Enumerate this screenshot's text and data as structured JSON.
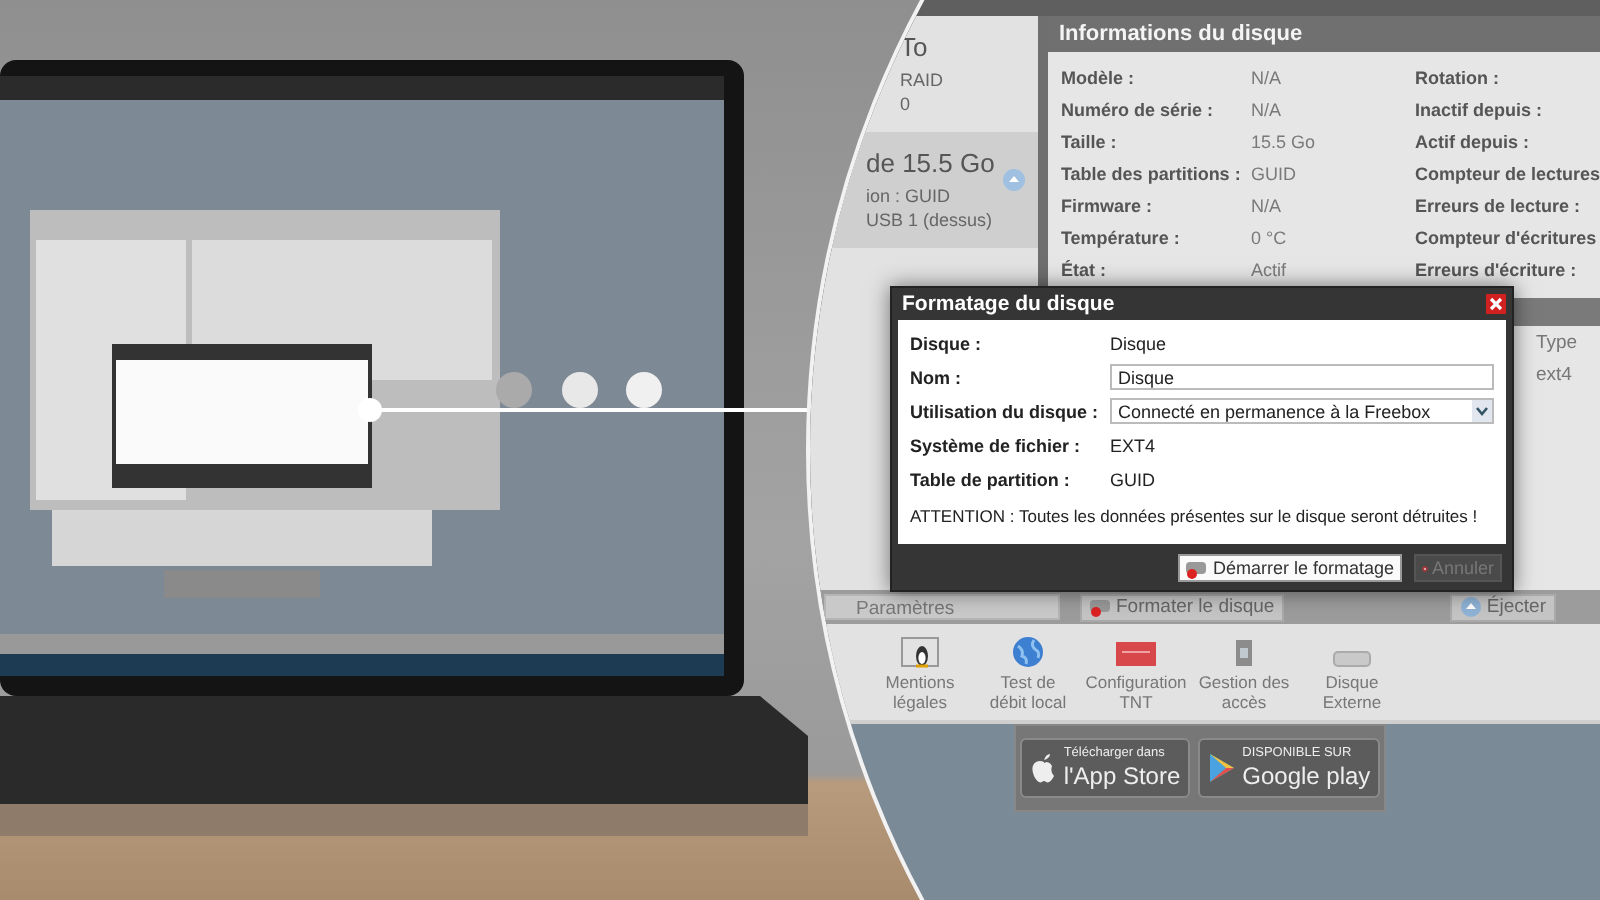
{
  "disk_list": {
    "items": [
      {
        "lines": [
          "To",
          "RAID",
          "0"
        ],
        "selected": false
      },
      {
        "lines": [
          "de 15.5 Go",
          "ion : GUID",
          "USB 1 (dessus)"
        ],
        "selected": true
      }
    ]
  },
  "disk_info": {
    "title": "Informations du disque",
    "rows": [
      {
        "label": "Modèle :",
        "value": "N/A",
        "label_2": "Rotation :"
      },
      {
        "label": "Numéro de série :",
        "value": "N/A",
        "label_2": "Inactif depuis :"
      },
      {
        "label": "Taille :",
        "value": "15.5 Go",
        "label_2": "Actif depuis :"
      },
      {
        "label": "Table des partitions :",
        "value": "GUID",
        "label_2": "Compteur de lectures"
      },
      {
        "label": "Firmware :",
        "value": "N/A",
        "label_2": "Erreurs de lecture :"
      },
      {
        "label": "Température :",
        "value": "0 °C",
        "label_2": "Compteur d'écritures"
      },
      {
        "label": "État :",
        "value": "Actif",
        "label_2": "Erreurs d'écriture :"
      }
    ]
  },
  "partitions_table": {
    "columns": [
      "Type"
    ],
    "rows": [
      [
        "ext4"
      ]
    ]
  },
  "format_dialog": {
    "title": "Formatage du disque",
    "fields": [
      {
        "kind": "text",
        "label": "Disque :",
        "value": "Disque"
      },
      {
        "kind": "input",
        "label": "Nom :",
        "value": "Disque"
      },
      {
        "kind": "select",
        "label": "Utilisation du disque :",
        "value": "Connecté en permanence à la Freebox"
      },
      {
        "kind": "text",
        "label": "Système de fichier :",
        "value": "EXT4"
      },
      {
        "kind": "text",
        "label": "Table de partition :",
        "value": "GUID"
      }
    ],
    "warning": "ATTENTION : Toutes les données présentes sur le disque seront détruites !",
    "buttons": [
      {
        "label": "Démarrer le formatage",
        "disabled": false
      },
      {
        "label": "Annuler",
        "disabled": true
      }
    ]
  },
  "toolbar": {
    "field": "Paramètres",
    "buttons": [
      {
        "label": "Formater le disque",
        "kind": "format"
      },
      {
        "label": "Éjecter",
        "kind": "eject"
      }
    ]
  },
  "apps": [
    {
      "kind": "penguin",
      "lines": [
        "Mentions",
        "légales"
      ]
    },
    {
      "kind": "globe",
      "lines": [
        "Test de",
        "débit local"
      ]
    },
    {
      "kind": "tv",
      "lines": [
        "Configuration",
        "TNT"
      ]
    },
    {
      "kind": "lock",
      "lines": [
        "Gestion des",
        "accès"
      ]
    },
    {
      "kind": "drive",
      "lines": [
        "Disque",
        "Externe"
      ]
    }
  ],
  "store_badges": [
    {
      "kind": "apple",
      "small": "Télécharger dans",
      "big": "l'App Store"
    },
    {
      "kind": "google",
      "small": "DISPONIBLE SUR",
      "big": "Google play"
    }
  ]
}
